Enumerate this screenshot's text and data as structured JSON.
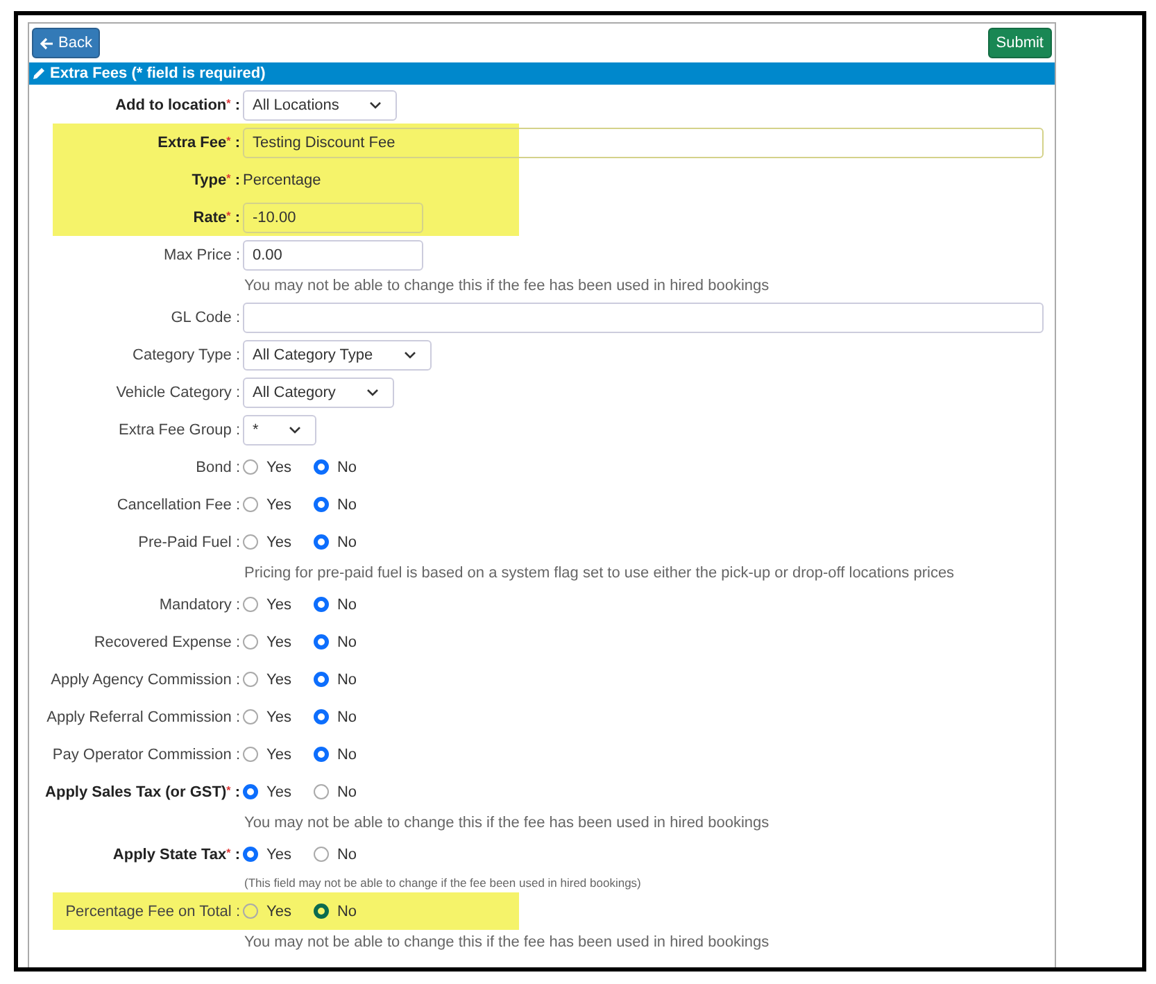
{
  "toolbar": {
    "back": "Back",
    "submit": "Submit"
  },
  "panel": {
    "title": "Extra Fees (* field is required)"
  },
  "rows": [
    {
      "kind": "select",
      "label": "Add to location",
      "star": "*",
      "colon": ":",
      "required": true,
      "highlighted": false,
      "value": "All Locations"
    },
    {
      "kind": "input",
      "label": "Extra Fee",
      "star": "*",
      "colon": ":",
      "required": true,
      "highlighted": true,
      "wide": true,
      "value": "Testing Discount Fee"
    },
    {
      "kind": "static",
      "label": "Type",
      "star": "*",
      "colon": ":",
      "required": true,
      "highlighted": true,
      "value": "Percentage"
    },
    {
      "kind": "input",
      "label": "Rate",
      "star": "*",
      "colon": ":",
      "required": true,
      "highlighted": true,
      "wide": false,
      "value": "-10.00"
    },
    {
      "kind": "input",
      "label": "Max Price",
      "colon": ":",
      "required": false,
      "highlighted": false,
      "wide": false,
      "value": "0.00",
      "note": "You may not be able to change this if the fee has been used in hired bookings",
      "note_small": false
    },
    {
      "kind": "input",
      "label": "GL Code",
      "colon": ":",
      "required": false,
      "highlighted": false,
      "wide": true
    },
    {
      "kind": "select",
      "label": "Category Type",
      "colon": ":",
      "required": false,
      "highlighted": false,
      "value": "All Category Type"
    },
    {
      "kind": "select",
      "label": "Vehicle Category",
      "colon": ":",
      "required": false,
      "highlighted": false,
      "value": "All Category"
    },
    {
      "kind": "select",
      "label": "Extra Fee Group",
      "colon": ":",
      "required": false,
      "highlighted": false,
      "value": "*"
    },
    {
      "kind": "radio",
      "label": "Bond",
      "colon": ":",
      "required": false,
      "highlighted": false,
      "options": [
        {
          "label": "Yes",
          "selected": false
        },
        {
          "label": "No",
          "selected": true
        }
      ]
    },
    {
      "kind": "radio",
      "label": "Cancellation Fee",
      "colon": ":",
      "required": false,
      "highlighted": false,
      "options": [
        {
          "label": "Yes",
          "selected": false
        },
        {
          "label": "No",
          "selected": true
        }
      ]
    },
    {
      "kind": "radio",
      "label": "Pre-Paid Fuel",
      "colon": ":",
      "required": false,
      "highlighted": false,
      "options": [
        {
          "label": "Yes",
          "selected": false
        },
        {
          "label": "No",
          "selected": true
        }
      ],
      "note": "Pricing for pre-paid fuel is based on a system flag set to use either the pick-up or drop-off locations prices",
      "note_small": false
    },
    {
      "kind": "radio",
      "label": "Mandatory",
      "colon": ":",
      "required": false,
      "highlighted": false,
      "options": [
        {
          "label": "Yes",
          "selected": false
        },
        {
          "label": "No",
          "selected": true
        }
      ]
    },
    {
      "kind": "radio",
      "label": "Recovered Expense",
      "colon": ":",
      "required": false,
      "highlighted": false,
      "options": [
        {
          "label": "Yes",
          "selected": false
        },
        {
          "label": "No",
          "selected": true
        }
      ]
    },
    {
      "kind": "radio",
      "label": "Apply Agency Commission",
      "colon": ":",
      "required": false,
      "highlighted": false,
      "options": [
        {
          "label": "Yes",
          "selected": false
        },
        {
          "label": "No",
          "selected": true
        }
      ]
    },
    {
      "kind": "radio",
      "label": "Apply Referral Commission",
      "colon": ":",
      "required": false,
      "highlighted": false,
      "options": [
        {
          "label": "Yes",
          "selected": false
        },
        {
          "label": "No",
          "selected": true
        }
      ]
    },
    {
      "kind": "radio",
      "label": "Pay Operator Commission",
      "colon": ":",
      "required": false,
      "highlighted": false,
      "options": [
        {
          "label": "Yes",
          "selected": false
        },
        {
          "label": "No",
          "selected": true
        }
      ]
    },
    {
      "kind": "radio",
      "label": "Apply Sales Tax (or GST)",
      "star": "*",
      "colon": ":",
      "required": true,
      "highlighted": false,
      "options": [
        {
          "label": "Yes",
          "selected": true
        },
        {
          "label": "No",
          "selected": false
        }
      ],
      "note": "You may not be able to change this if the fee has been used in hired bookings",
      "note_small": false
    },
    {
      "kind": "radio",
      "label": "Apply State Tax",
      "star": "*",
      "colon": ":",
      "required": true,
      "highlighted": false,
      "options": [
        {
          "label": "Yes",
          "selected": true
        },
        {
          "label": "No",
          "selected": false
        }
      ],
      "note": "(This field may not be able to change if the fee been used in hired bookings)",
      "note_small": true
    },
    {
      "kind": "radio",
      "label": "Percentage Fee on Total",
      "colon": ":",
      "required": false,
      "highlighted": true,
      "options": [
        {
          "label": "Yes",
          "selected": false
        },
        {
          "label": "No",
          "selected": true
        }
      ],
      "note": "You may not be able to change this if the fee has been used in hired bookings",
      "note_small": false
    }
  ]
}
